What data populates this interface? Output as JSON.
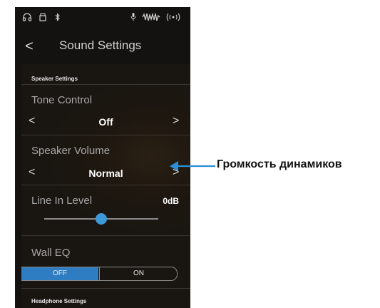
{
  "status_bar": {
    "icons_left": [
      "headphones-icon",
      "usb-icon",
      "bluetooth-icon"
    ],
    "icons_right": [
      "microphone-icon",
      "audio-wave-icon",
      "wireless-icon"
    ]
  },
  "nav": {
    "back_icon": "chevron-left-icon",
    "back_glyph": "<",
    "title": "Sound Settings"
  },
  "speaker_settings": {
    "header": "Speaker Settings",
    "tone_control": {
      "label": "Tone Control",
      "value": "Off",
      "prev": "<",
      "next": ">"
    },
    "speaker_volume": {
      "label": "Speaker Volume",
      "value": "Normal",
      "prev": "<",
      "next": ">"
    },
    "line_in_level": {
      "label": "Line In Level",
      "value": "0dB",
      "slider_fraction": 0.5
    },
    "wall_eq": {
      "label": "Wall EQ",
      "off_label": "OFF",
      "on_label": "ON",
      "selected": "OFF"
    }
  },
  "headphone_settings": {
    "header": "Headphone Settings"
  },
  "annotation": {
    "text": "Громкость динамиков",
    "color": "#2a8fd8"
  },
  "colors": {
    "accent": "#2e7dc2",
    "slider_thumb": "#3d9ad6",
    "background": "#141210"
  }
}
